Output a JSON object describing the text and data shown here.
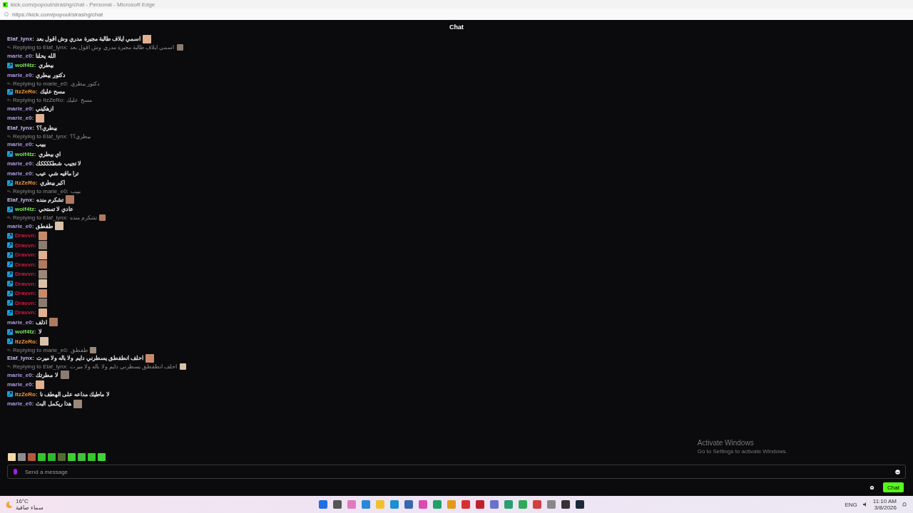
{
  "browser": {
    "title": "kick.com/popout/sirashg/chat - Personal - Microsoft Edge",
    "url": "https://kick.com/popout/sirashg/chat"
  },
  "header": {
    "title": "Chat"
  },
  "messages": [
    {
      "badge": false,
      "user": "Elaf_lynx:",
      "color": "#c9b8ee",
      "text": "اسمي ايلاف طالبة مجبرة مدري وش اقول بعد",
      "emote": true
    },
    {
      "reply": {
        "label": "Replying to Elaf_lynx:",
        "text": "اسمي ايلاف طالبة مجبرة مدري وش اقول بعد",
        "emote": true
      },
      "badge": false,
      "user": "marie_e0:",
      "color": "#b09ae0",
      "text": "الله يحلنا",
      "emote": false
    },
    {
      "badge": true,
      "user": "wolf4tz:",
      "color": "#7be357",
      "text": "بيطري",
      "emote": false
    },
    {
      "badge": false,
      "user": "marie_e0:",
      "color": "#b09ae0",
      "text": "دكتور بيطري",
      "emote": false
    },
    {
      "reply": {
        "label": "Replying to marie_e0:",
        "text": "دكتور بيطري",
        "emote": false
      },
      "badge": true,
      "user": "ItzZeRo:",
      "color": "#f5953a",
      "text": "مسح عليك",
      "emote": false
    },
    {
      "reply": {
        "label": "Replying to ItzZeRo:",
        "text": "مسح عليك",
        "emote": false
      },
      "badge": false,
      "user": "marie_e0:",
      "color": "#b09ae0",
      "text": "ازهكيني",
      "emote": false
    },
    {
      "badge": false,
      "user": "marie_e0:",
      "color": "#b09ae0",
      "emote": true
    },
    {
      "badge": false,
      "user": "Elaf_lynx:",
      "color": "#c9b8ee",
      "text": "بيطري؟؟",
      "emote": false
    },
    {
      "reply": {
        "label": "Replying to Elaf_lynx:",
        "text": "بيطري؟؟",
        "emote": false
      },
      "badge": false,
      "user": "marie_e0:",
      "color": "#b09ae0",
      "text": "ببيب",
      "emote": false
    },
    {
      "badge": true,
      "user": "wolf4tz:",
      "color": "#7be357",
      "text": "اي بيطري",
      "emote": false
    },
    {
      "badge": false,
      "user": "marie_e0:",
      "color": "#b09ae0",
      "text": "لا تجيب شطككككك",
      "emote": false
    },
    {
      "badge": false,
      "user": "marie_e0:",
      "color": "#b09ae0",
      "text": "ترا ماقيه شي عيب",
      "emote": false
    },
    {
      "badge": true,
      "user": "ItzZeRo:",
      "color": "#f5953a",
      "text": "اكبر بيطري",
      "emote": false
    },
    {
      "reply": {
        "label": "Replying to marie_e0:",
        "text": "ببيب",
        "emote": false
      },
      "badge": false,
      "user": "Elaf_lynx:",
      "color": "#c9b8ee",
      "text": "تشكرم منده",
      "emote": true
    },
    {
      "badge": true,
      "user": "wolf4tz:",
      "color": "#7be357",
      "text": "عادي لا تستحي",
      "emote": false
    },
    {
      "reply": {
        "label": "Replying to Elaf_lynx:",
        "text": "تشكرم منده",
        "emote": true
      },
      "badge": false,
      "user": "marie_e0:",
      "color": "#b09ae0",
      "text": "طفطق",
      "emote": true
    },
    {
      "badge": true,
      "user": "Dravvn:",
      "color": "#d3173f",
      "emote": true
    },
    {
      "badge": true,
      "user": "Dravvn:",
      "color": "#d3173f",
      "emote": true
    },
    {
      "badge": true,
      "user": "Dravvn:",
      "color": "#d3173f",
      "emote": true
    },
    {
      "badge": true,
      "user": "Dravvn:",
      "color": "#d3173f",
      "emote": true
    },
    {
      "badge": true,
      "user": "Dravvn:",
      "color": "#d3173f",
      "emote": true
    },
    {
      "badge": true,
      "user": "Dravvn:",
      "color": "#d3173f",
      "emote": true
    },
    {
      "badge": true,
      "user": "Dravvn:",
      "color": "#d3173f",
      "emote": true
    },
    {
      "badge": true,
      "user": "Dravvn:",
      "color": "#d3173f",
      "emote": true
    },
    {
      "badge": true,
      "user": "Dravvn:",
      "color": "#d3173f",
      "emote": true
    },
    {
      "badge": false,
      "user": "marie_e0:",
      "color": "#b09ae0",
      "text": "اذلف",
      "emote": true
    },
    {
      "badge": true,
      "user": "wolf4tz:",
      "color": "#7be357",
      "text": "لا",
      "emote": false
    },
    {
      "badge": true,
      "user": "ItzZeRo:",
      "color": "#f5953a",
      "emote": true
    },
    {
      "reply": {
        "label": "Replying to marie_e0:",
        "text": "طفطق",
        "emote": true
      },
      "badge": false,
      "user": "Elaf_lynx:",
      "color": "#c9b8ee",
      "text": "احلف انطفطق يسطرني دايم ولا باله ولا ميرت",
      "emote": true
    },
    {
      "reply": {
        "label": "Replying to Elaf_lynx:",
        "text": "احلف انطفطق يسطرني دايم ولا باله ولا ميرت",
        "emote": true
      },
      "badge": false,
      "user": "marie_e0:",
      "color": "#b09ae0",
      "text": "لا مطرتك",
      "emote": true
    },
    {
      "badge": false,
      "user": "marie_e0:",
      "color": "#b09ae0",
      "emote": true
    },
    {
      "badge": true,
      "user": "ItzZeRo:",
      "color": "#f5953a",
      "text": "لا ماطيك مداعه على الهطف نا",
      "emote": false
    },
    {
      "badge": false,
      "user": "marie_e0:",
      "color": "#b09ae0",
      "text": "هذا ريكمل البث",
      "emote": true
    }
  ],
  "input": {
    "placeholder": "Send a message"
  },
  "send_button": "Chat",
  "activation_notice": {
    "title": "Activate Windows",
    "text": "Go to Settings to activate Windows."
  },
  "taskbar": {
    "temperature": "16°C",
    "weather": "سماء صافية",
    "language": "ENG",
    "time": "11:10 AM",
    "date": "3/8/2026"
  }
}
